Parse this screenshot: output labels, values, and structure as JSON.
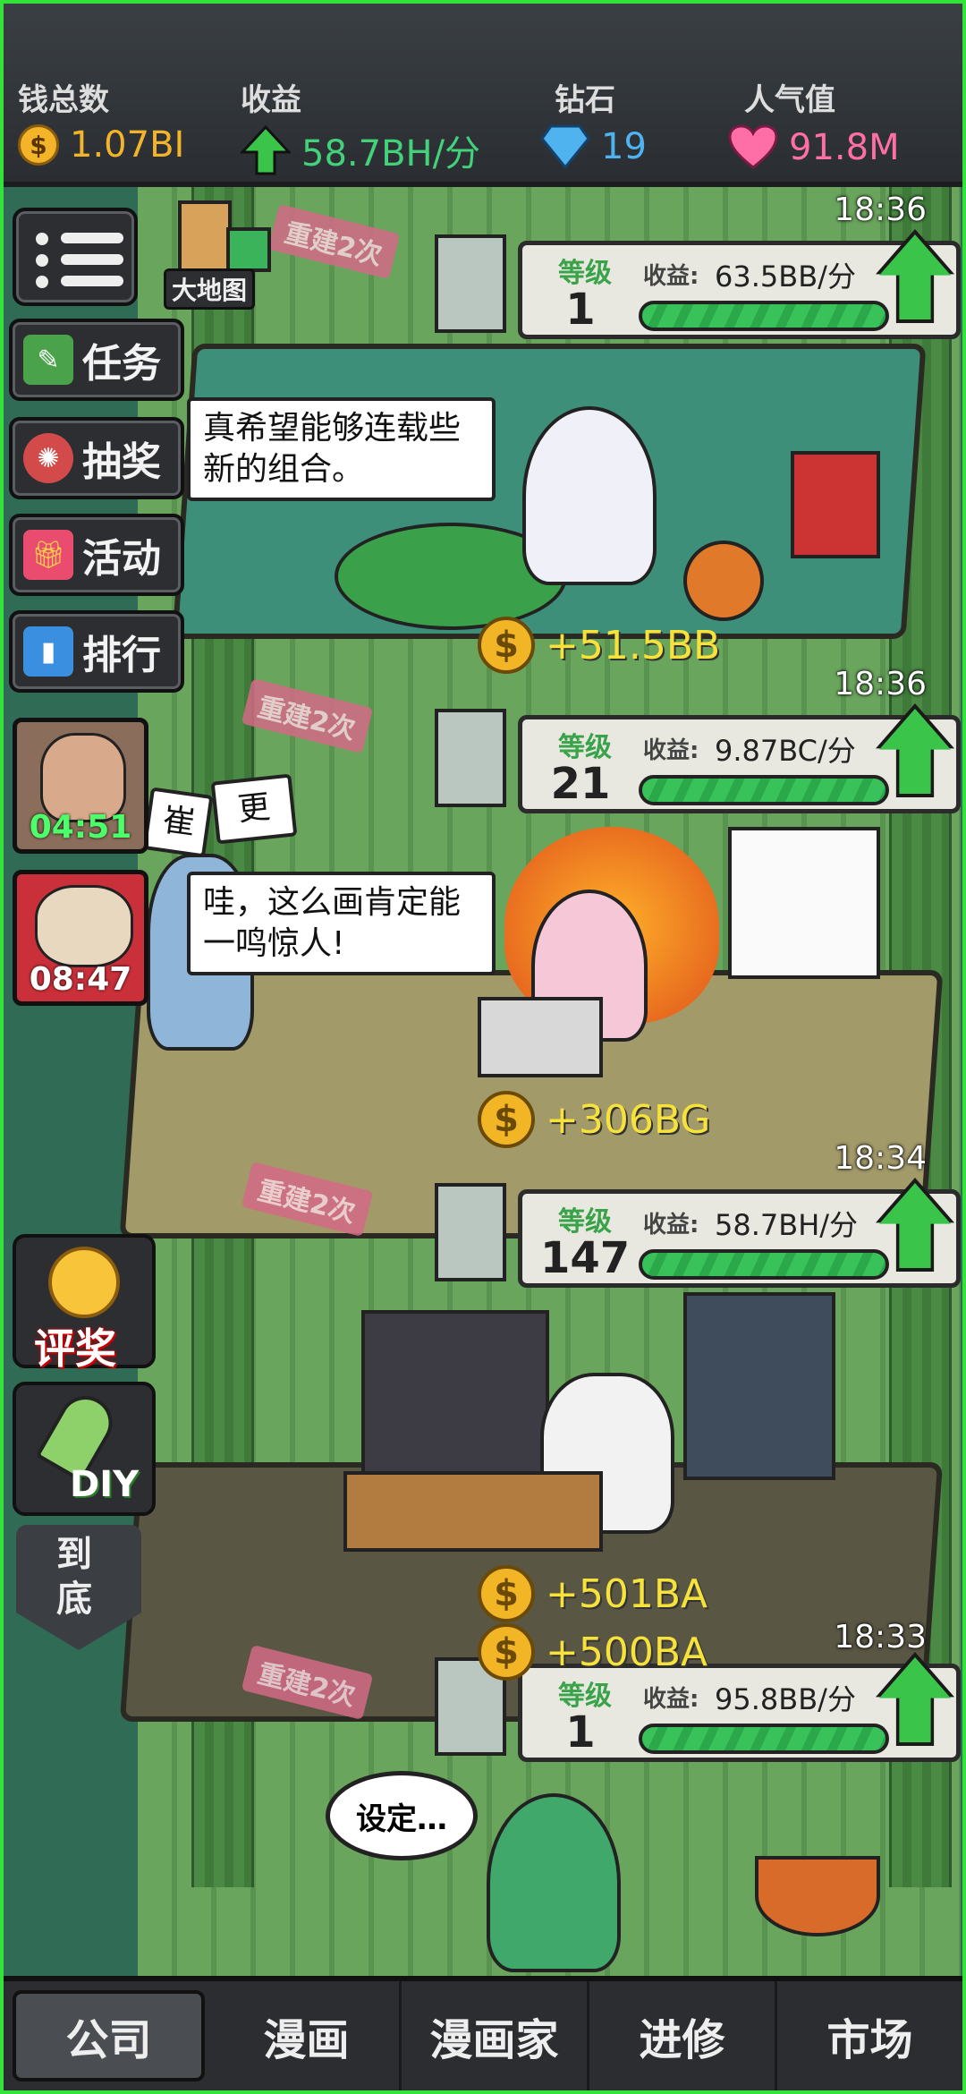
{
  "stats": {
    "money_label": "钱总数",
    "money_value": "1.07BI",
    "income_label": "收益",
    "income_value": "58.7BH/分",
    "diamond_label": "钻石",
    "diamond_value": "19",
    "popularity_label": "人气值",
    "popularity_value": "91.8M"
  },
  "sidebar": {
    "map_label": "大地图",
    "tasks": "任务",
    "lottery": "抽奖",
    "events": "活动",
    "ranking": "排行",
    "timer1": "04:51",
    "timer2": "08:47",
    "award": "评奖",
    "diy": "DIY",
    "bottom": "到底"
  },
  "floors": [
    {
      "time": "18:36",
      "level_label": "等级",
      "level": "1",
      "income_label": "收益:",
      "income": "63.5BB/分"
    },
    {
      "time": "18:36",
      "level_label": "等级",
      "level": "21",
      "income_label": "收益:",
      "income": "9.87BC/分"
    },
    {
      "time": "18:34",
      "level_label": "等级",
      "level": "147",
      "income_label": "收益:",
      "income": "58.7BH/分"
    },
    {
      "time": "18:33",
      "level_label": "等级",
      "level": "1",
      "income_label": "收益:",
      "income": "95.8BB/分"
    }
  ],
  "bubbles": {
    "b1": "真希望能够连载些新的组合。",
    "b2": "哇，这么画肯定能一鸣惊人!",
    "b3": "设定…",
    "sign1": "更",
    "sign2": "崔"
  },
  "income_pops": [
    "+51.5BB",
    "+306BG",
    "+501BA",
    "+500BA"
  ],
  "rebuild": "重建2次",
  "tabs": [
    "公司",
    "漫画",
    "漫画家",
    "进修",
    "市场"
  ],
  "colors": {
    "accent_green": "#3ac44a",
    "income_yellow": "#f6e23a",
    "income_text": "#43d17a",
    "popularity": "#ff6fa7",
    "diamond": "#4fb3f0"
  }
}
